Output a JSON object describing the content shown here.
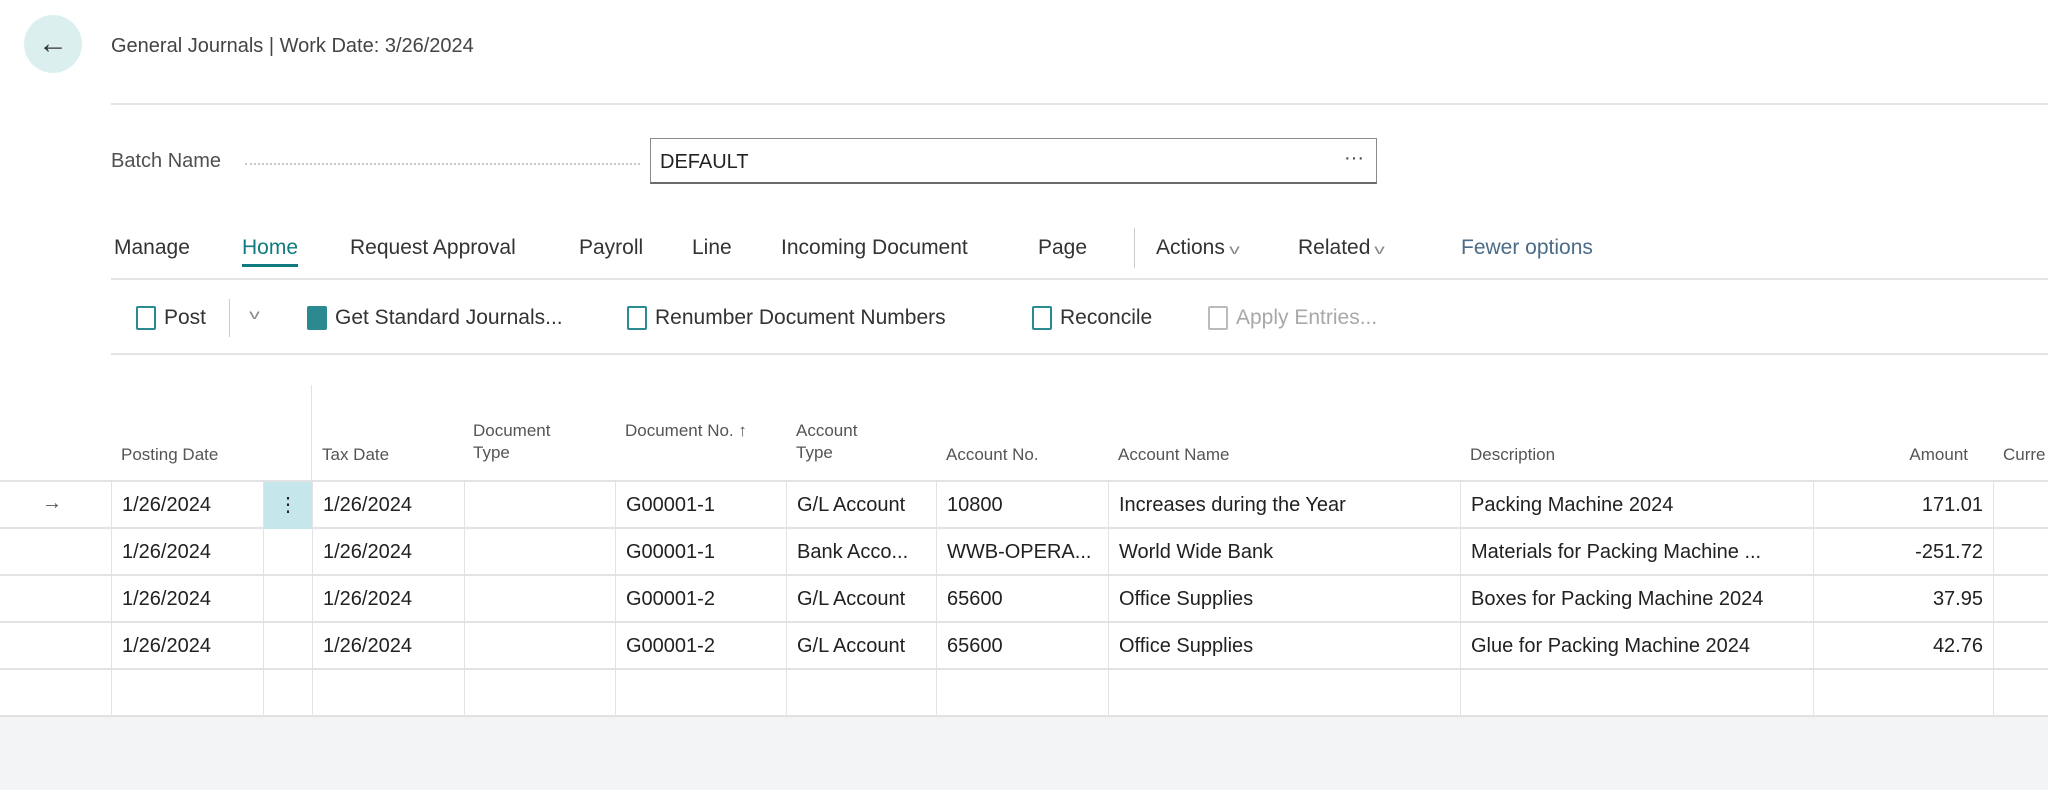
{
  "header": {
    "title": "General Journals | Work Date: 3/26/2024"
  },
  "batch": {
    "label": "Batch Name",
    "value": "DEFAULT",
    "more": "···"
  },
  "tabs": [
    {
      "label": "Manage"
    },
    {
      "label": "Home",
      "active": true
    },
    {
      "label": "Request Approval"
    },
    {
      "label": "Payroll"
    },
    {
      "label": "Line"
    },
    {
      "label": "Incoming Document"
    },
    {
      "label": "Page"
    },
    {
      "label": "Actions"
    },
    {
      "label": "Related"
    },
    {
      "label": "Fewer options"
    }
  ],
  "actions": {
    "post": "Post",
    "get_standard": "Get Standard Journals...",
    "renumber": "Renumber Document Numbers",
    "reconcile": "Reconcile",
    "apply": "Apply Entries..."
  },
  "table": {
    "headers": [
      "Posting Date",
      "Tax Date",
      "Document Type",
      "Document No. ↑",
      "Account Type",
      "Account No.",
      "Account Name",
      "Description",
      "Amount",
      "Curre"
    ],
    "rows": [
      [
        "1/26/2024",
        "1/26/2024",
        "",
        "G00001-1",
        "G/L Account",
        "10800",
        "Increases during the Year",
        "Packing Machine 2024",
        "171.01",
        ""
      ],
      [
        "1/26/2024",
        "1/26/2024",
        "",
        "G00001-1",
        "Bank Acco...",
        "WWB-OPERA...",
        "World Wide Bank",
        "Materials for Packing Machine ...",
        "-251.72",
        ""
      ],
      [
        "1/26/2024",
        "1/26/2024",
        "",
        "G00001-2",
        "G/L Account",
        "65600",
        "Office Supplies",
        "Boxes for Packing Machine 2024",
        "37.95",
        ""
      ],
      [
        "1/26/2024",
        "1/26/2024",
        "",
        "G00001-2",
        "G/L Account",
        "65600",
        "Office Supplies",
        "Glue for Packing Machine 2024",
        "42.76",
        ""
      ]
    ]
  },
  "colors": {
    "accent": "#0f7b80",
    "selected_cell": "#c5e6ea"
  }
}
